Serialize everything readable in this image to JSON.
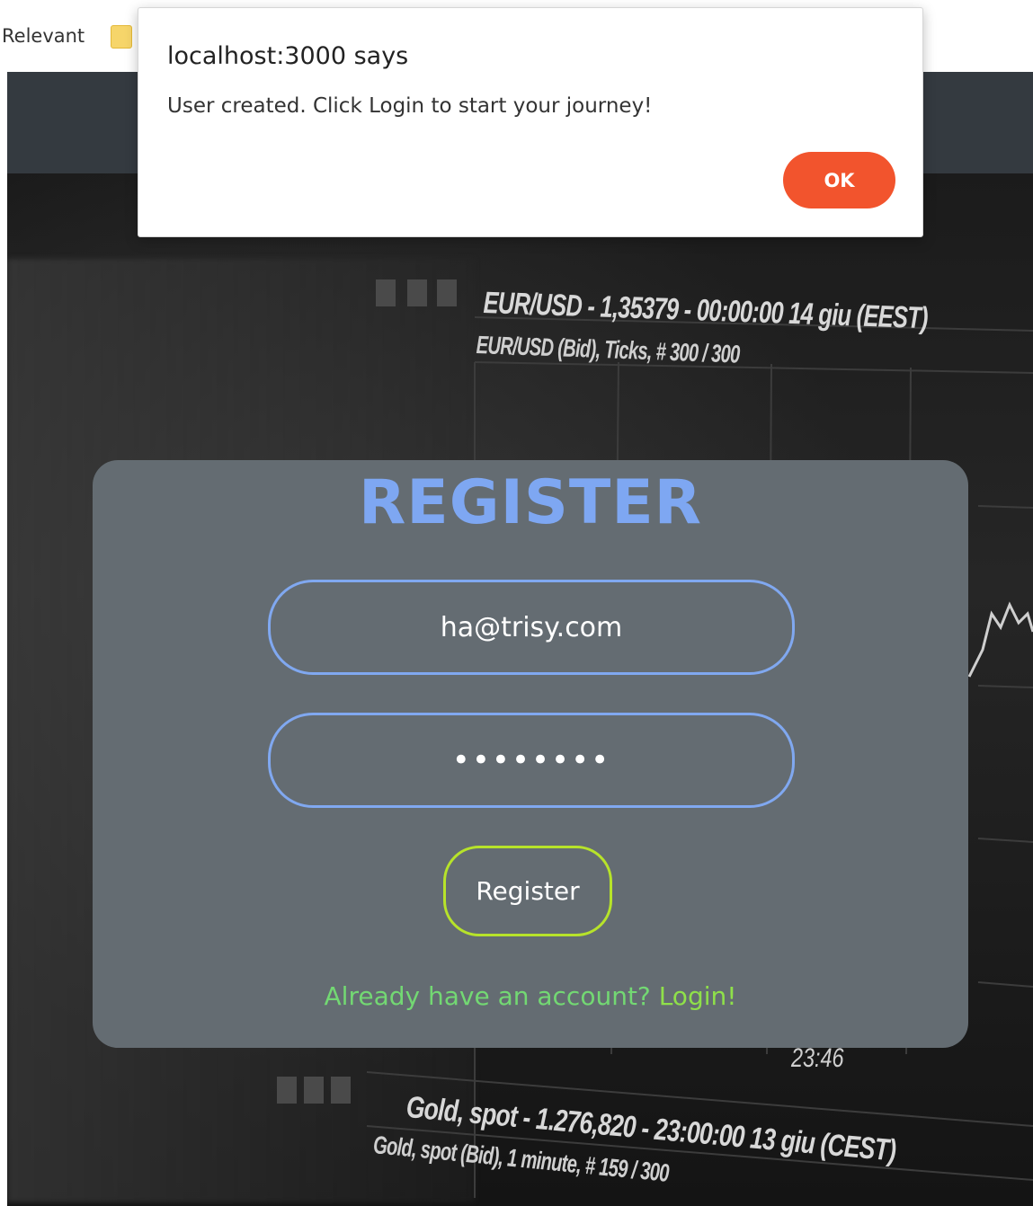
{
  "browser": {
    "bookmark_label": "Relevant",
    "bookmark_folder_icon": "folder-icon"
  },
  "background": {
    "chart_top_title": "EUR/USD - 1,35379 - 00:00:00  14 giu (EEST)",
    "chart_top_subtitle": "EUR/USD (Bid), Ticks, # 300 / 300",
    "time_label": "23:46",
    "chart_bottom_title": "Gold, spot - 1.276,820 - 23:00:00  13 giu (CEST)",
    "chart_bottom_subtitle": "Gold, spot (Bid), 1 minute, # 159 / 300"
  },
  "register": {
    "title": "REGISTER",
    "email_value": "ha@trisy.com",
    "password_value": "••••••••",
    "button_label": "Register",
    "login_prompt": "Already have an account?",
    "login_link": "Login!"
  },
  "alert": {
    "title": "localhost:3000 says",
    "message": "User created. Click Login to start your journey!",
    "ok_label": "OK",
    "ok_color": "#f2542d"
  },
  "colors": {
    "title_blue": "#7ea7f2",
    "field_border": "#80a8f0",
    "button_border": "#b7e32a",
    "login_text": "#73d873",
    "card_bg": "#646c72",
    "nav_bg": "#343a40"
  }
}
